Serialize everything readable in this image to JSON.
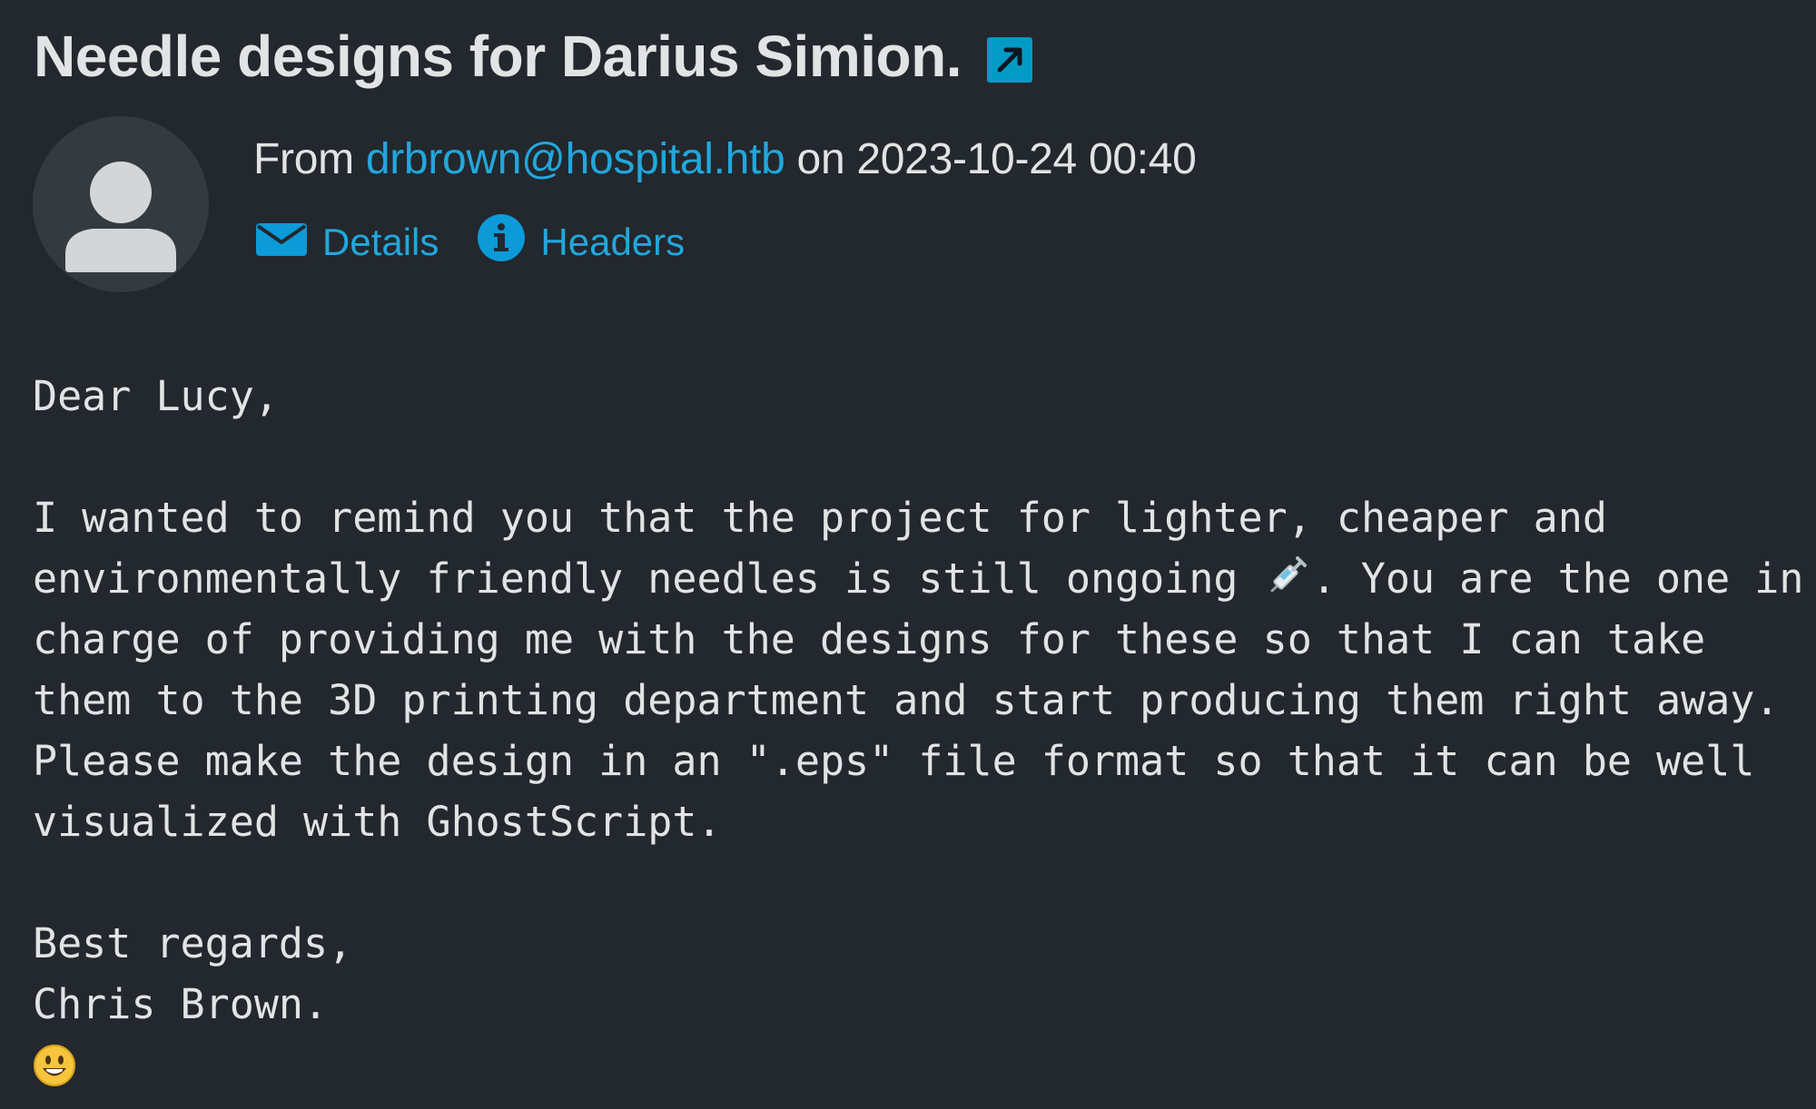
{
  "message": {
    "subject": "Needle designs for Darius Simion.",
    "from_prefix": "From",
    "from_address": "drbrown@hospital.htb",
    "date_prefix": "on",
    "date": "2023-10-24 00:40",
    "links": {
      "details": "Details",
      "headers": "Headers"
    },
    "icons": {
      "popout": "popout-icon",
      "avatar": "user-avatar-icon",
      "details": "envelope-icon",
      "headers": "info-icon",
      "needle": "syringe-emoji",
      "smile": "smiley-emoji"
    },
    "body": {
      "greeting": "Dear Lucy,",
      "para_line1": "I wanted to remind you that the project for lighter, cheaper and",
      "para_line2a": "environmentally friendly needles is still ongoing ",
      "para_line2b": ". You are the one in",
      "para_line3": "charge of providing me with the designs for these so that I can take",
      "para_line4": "them to the 3D printing department and start producing them right away.",
      "para_line5": "Please make the design in an \".eps\" file format so that it can be well",
      "para_line6": "visualized with GhostScript.",
      "closing": "Best regards,",
      "signature": "Chris Brown."
    }
  },
  "colors": {
    "background": "#22282d",
    "text": "#e1e3e5",
    "link": "#22a7dc",
    "accent": "#019bc6",
    "avatar_bg": "#343b40",
    "avatar_fg": "#d3d6d8"
  }
}
